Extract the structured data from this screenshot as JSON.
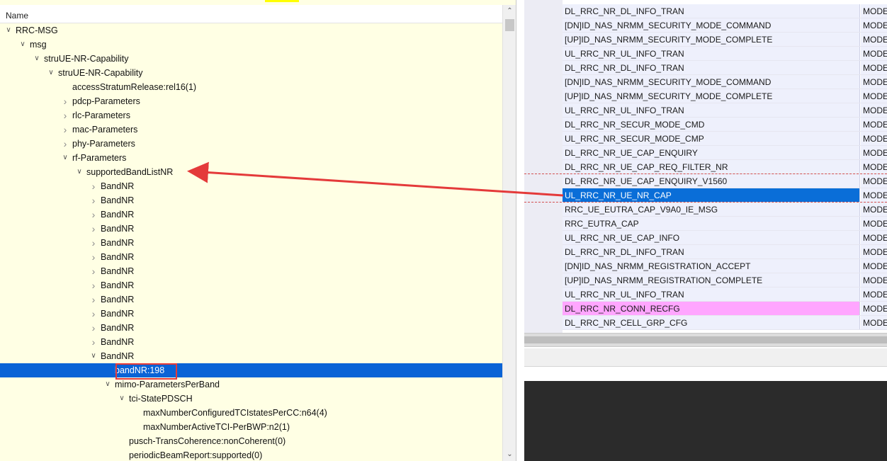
{
  "tree": {
    "header": "Name",
    "rows": [
      {
        "label": "RRC-MSG",
        "caret": "v"
      },
      {
        "label": "msg",
        "caret": "v"
      },
      {
        "label": "struUE-NR-Capability",
        "caret": "v"
      },
      {
        "label": "struUE-NR-Capability",
        "caret": "v"
      },
      {
        "label": "accessStratumRelease:rel16(1)",
        "caret": ""
      },
      {
        "label": "pdcp-Parameters",
        "caret": ">"
      },
      {
        "label": "rlc-Parameters",
        "caret": ">"
      },
      {
        "label": "mac-Parameters",
        "caret": ">"
      },
      {
        "label": "phy-Parameters",
        "caret": ">"
      },
      {
        "label": "rf-Parameters",
        "caret": "v"
      },
      {
        "label": "supportedBandListNR",
        "caret": "v"
      },
      {
        "label": "BandNR",
        "caret": ">"
      },
      {
        "label": "BandNR",
        "caret": ">"
      },
      {
        "label": "BandNR",
        "caret": ">"
      },
      {
        "label": "BandNR",
        "caret": ">"
      },
      {
        "label": "BandNR",
        "caret": ">"
      },
      {
        "label": "BandNR",
        "caret": ">"
      },
      {
        "label": "BandNR",
        "caret": ">"
      },
      {
        "label": "BandNR",
        "caret": ">"
      },
      {
        "label": "BandNR",
        "caret": ">"
      },
      {
        "label": "BandNR",
        "caret": ">"
      },
      {
        "label": "BandNR",
        "caret": ">"
      },
      {
        "label": "BandNR",
        "caret": ">"
      },
      {
        "label": "BandNR",
        "caret": "v"
      },
      {
        "label": "bandNR:198",
        "caret": "",
        "selected": true
      },
      {
        "label": "mimo-ParametersPerBand",
        "caret": "v"
      },
      {
        "label": "tci-StatePDSCH",
        "caret": "v"
      },
      {
        "label": "maxNumberConfiguredTCIstatesPerCC:n64(4)",
        "caret": ""
      },
      {
        "label": "maxNumberActiveTCI-PerBWP:n2(1)",
        "caret": ""
      },
      {
        "label": "pusch-TransCoherence:nonCoherent(0)",
        "caret": ""
      },
      {
        "label": "periodicBeamReport:supported(0)",
        "caret": ""
      }
    ]
  },
  "messages": {
    "rows": [
      {
        "name": "DL_RRC_NR_DL_INFO_TRAN",
        "mode": "MODE"
      },
      {
        "name": "[DN]ID_NAS_NRMM_SECURITY_MODE_COMMAND",
        "mode": "MODE"
      },
      {
        "name": "[UP]ID_NAS_NRMM_SECURITY_MODE_COMPLETE",
        "mode": "MODE"
      },
      {
        "name": "UL_RRC_NR_UL_INFO_TRAN",
        "mode": "MODE"
      },
      {
        "name": "DL_RRC_NR_DL_INFO_TRAN",
        "mode": "MODE"
      },
      {
        "name": "[DN]ID_NAS_NRMM_SECURITY_MODE_COMMAND",
        "mode": "MODE"
      },
      {
        "name": "[UP]ID_NAS_NRMM_SECURITY_MODE_COMPLETE",
        "mode": "MODE"
      },
      {
        "name": "UL_RRC_NR_UL_INFO_TRAN",
        "mode": "MODE"
      },
      {
        "name": "DL_RRC_NR_SECUR_MODE_CMD",
        "mode": "MODE"
      },
      {
        "name": "UL_RRC_NR_SECUR_MODE_CMP",
        "mode": "MODE"
      },
      {
        "name": "DL_RRC_NR_UE_CAP_ENQUIRY",
        "mode": "MODE"
      },
      {
        "name": "DL_RRC_NR_UE_CAP_REQ_FILTER_NR",
        "mode": "MODE"
      },
      {
        "name": "DL_RRC_NR_UE_CAP_ENQUIRY_V1560",
        "mode": "MODE"
      },
      {
        "name": "UL_RRC_NR_UE_NR_CAP",
        "mode": "MODE",
        "selected": true
      },
      {
        "name": "RRC_UE_EUTRA_CAP_V9A0_IE_MSG",
        "mode": "MODE"
      },
      {
        "name": "RRC_EUTRA_CAP",
        "mode": "MODE"
      },
      {
        "name": "UL_RRC_NR_UE_CAP_INFO",
        "mode": "MODE"
      },
      {
        "name": "DL_RRC_NR_DL_INFO_TRAN",
        "mode": "MODE"
      },
      {
        "name": "[DN]ID_NAS_NRMM_REGISTRATION_ACCEPT",
        "mode": "MODE"
      },
      {
        "name": "[UP]ID_NAS_NRMM_REGISTRATION_COMPLETE",
        "mode": "MODE"
      },
      {
        "name": "UL_RRC_NR_UL_INFO_TRAN",
        "mode": "MODE"
      },
      {
        "name": "DL_RRC_NR_CONN_RECFG",
        "mode": "MODE",
        "highlight": "pink"
      },
      {
        "name": "DL_RRC_NR_CELL_GRP_CFG",
        "mode": "MODE"
      }
    ]
  },
  "colors": {
    "tree_bg": "#ffffe4",
    "selection": "#0a63d6",
    "annotation": "#e43a3a",
    "pink_row": "#ffa6ff"
  }
}
